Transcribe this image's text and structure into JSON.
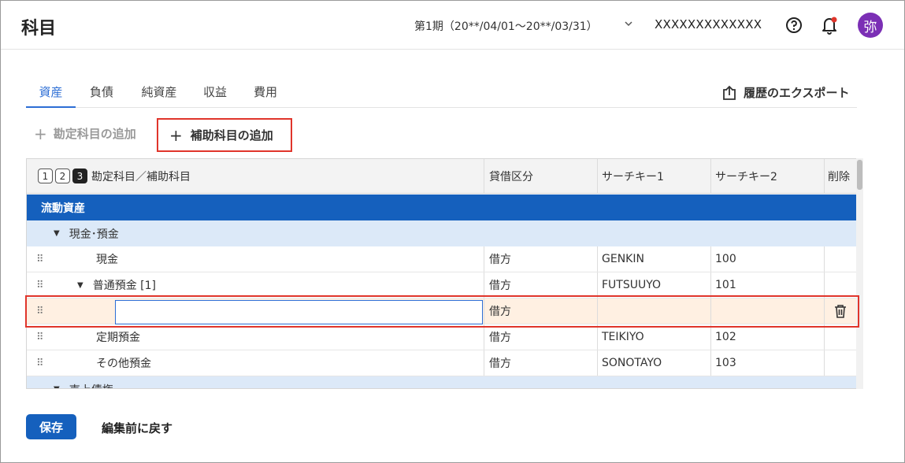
{
  "header": {
    "title": "科目",
    "period": "第1期（20**/04/01〜20**/03/31）",
    "company": "XXXXXXXXXXXXX",
    "avatar": "弥",
    "notification_dot_color": "#e0352b"
  },
  "tabs": [
    {
      "label": "資産",
      "active": true
    },
    {
      "label": "負債",
      "active": false
    },
    {
      "label": "純資産",
      "active": false
    },
    {
      "label": "収益",
      "active": false
    },
    {
      "label": "費用",
      "active": false
    }
  ],
  "export_label": "履歴のエクスポート",
  "actions": {
    "add_account": "勘定科目の追加",
    "add_sub_account": "補助科目の追加"
  },
  "table": {
    "levels": [
      "1",
      "2",
      "3"
    ],
    "columns": {
      "account": "勘定科目／補助科目",
      "side": "貸借区分",
      "key1": "サーチキー1",
      "key2": "サーチキー2",
      "delete": "削除"
    },
    "section": "流動資産",
    "group1": "現金･預金",
    "rows": [
      {
        "name": "現金",
        "side": "借方",
        "key1": "GENKIN",
        "key2": "100"
      },
      {
        "name": "普通預金 [1]",
        "side": "借方",
        "key1": "FUTSUUYO",
        "key2": "101"
      },
      {
        "name": "",
        "side": "借方",
        "key1": "",
        "key2": ""
      },
      {
        "name": "定期預金",
        "side": "借方",
        "key1": "TEIKIYO",
        "key2": "102"
      },
      {
        "name": "その他預金",
        "side": "借方",
        "key1": "SONOTAYO",
        "key2": "103"
      }
    ],
    "group2": "売上債権"
  },
  "footer": {
    "save": "保存",
    "revert": "編集前に戻す"
  },
  "colors": {
    "accent": "#1560bd",
    "highlight": "#e0352b",
    "group_bg": "#dce9f8",
    "edit_bg": "#fff0e2"
  }
}
